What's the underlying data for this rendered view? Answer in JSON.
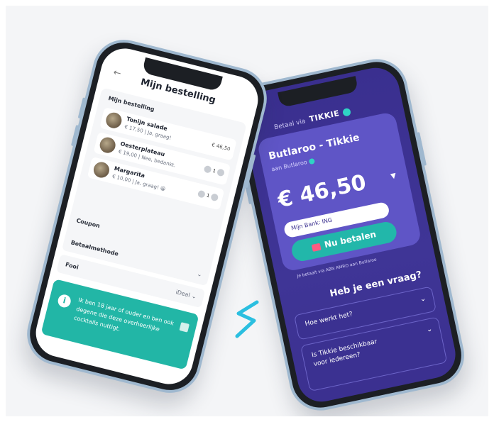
{
  "colors": {
    "tikkie_purple": "#3a2f8f",
    "teal": "#22b6a6",
    "frame": "#9fb8cf"
  },
  "left_phone": {
    "back_icon": "back-arrow-icon",
    "title": "Mijn bestelling",
    "section_label": "Mijn bestelling",
    "items": [
      {
        "name": "Tonijn salade",
        "meta": "€ 17,50 | Ja, graag!",
        "price": "€ 46,50"
      },
      {
        "name": "Oesterplateau",
        "meta": "€ 19,00 | Nee, bedankt.",
        "qty": "1"
      },
      {
        "name": "Margarita",
        "meta": "€ 10,00 | Ja, graag! 😀",
        "qty": "1"
      }
    ],
    "coupon_label": "Coupon",
    "method_label": "Betaalmethode",
    "tip_label": "Fooi",
    "tip_value": "iDeal",
    "consent_text": "Ik ben 18 jaar of ouder en ben ook degene die deze overheerlijke cocktails nuttigt.",
    "info_icon_text": "i"
  },
  "right_phone": {
    "via_text": "Betaal via",
    "brand": "TIKKIE",
    "merchant_title": "Butlaroo - Tikkie",
    "merchant_sub": "aan Butlaroo",
    "amount": "€ 46,50",
    "bank_select": "Mijn Bank: ING",
    "pay_button": "Nu betalen",
    "footnote": "Je betaalt via ABN AMRO aan Butlaroo",
    "faq_title": "Heb je een vraag?",
    "faq": [
      "Hoe werkt het?",
      "Is Tikkie beschikbaar voor iedereen?"
    ]
  }
}
